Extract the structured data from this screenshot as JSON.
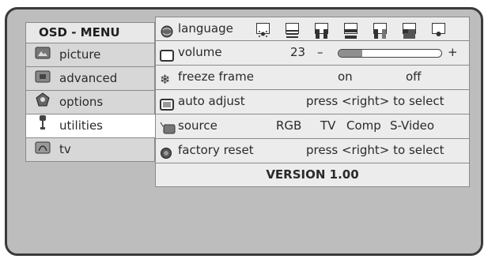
{
  "osd_title": "OSD - MENU",
  "sidebar": {
    "items": [
      {
        "label": "picture",
        "icon": "picture-icon"
      },
      {
        "label": "advanced",
        "icon": "advanced-icon"
      },
      {
        "label": "options",
        "icon": "options-icon"
      },
      {
        "label": "utilities",
        "icon": "utilities-icon",
        "selected": true
      },
      {
        "label": "tv",
        "icon": "tv-icon"
      }
    ]
  },
  "panel": {
    "language": {
      "label": "language",
      "icon": "globe-icon",
      "flags": [
        "flag-1",
        "flag-2",
        "flag-3",
        "flag-4",
        "flag-5",
        "flag-6",
        "flag-7"
      ]
    },
    "volume": {
      "label": "volume",
      "value": "23",
      "minus": "–",
      "plus": "+",
      "level": 0.23
    },
    "freeze_frame": {
      "label": "freeze frame",
      "on": "on",
      "off": "off"
    },
    "auto_adjust": {
      "label": "auto adjust",
      "hint": "press <right> to select"
    },
    "source": {
      "label": "source",
      "options": [
        "RGB",
        "TV",
        "Comp",
        "S-Video"
      ]
    },
    "factory_reset": {
      "label": "factory reset",
      "hint": "press <right> to select"
    }
  },
  "version": "VERSION 1.00"
}
